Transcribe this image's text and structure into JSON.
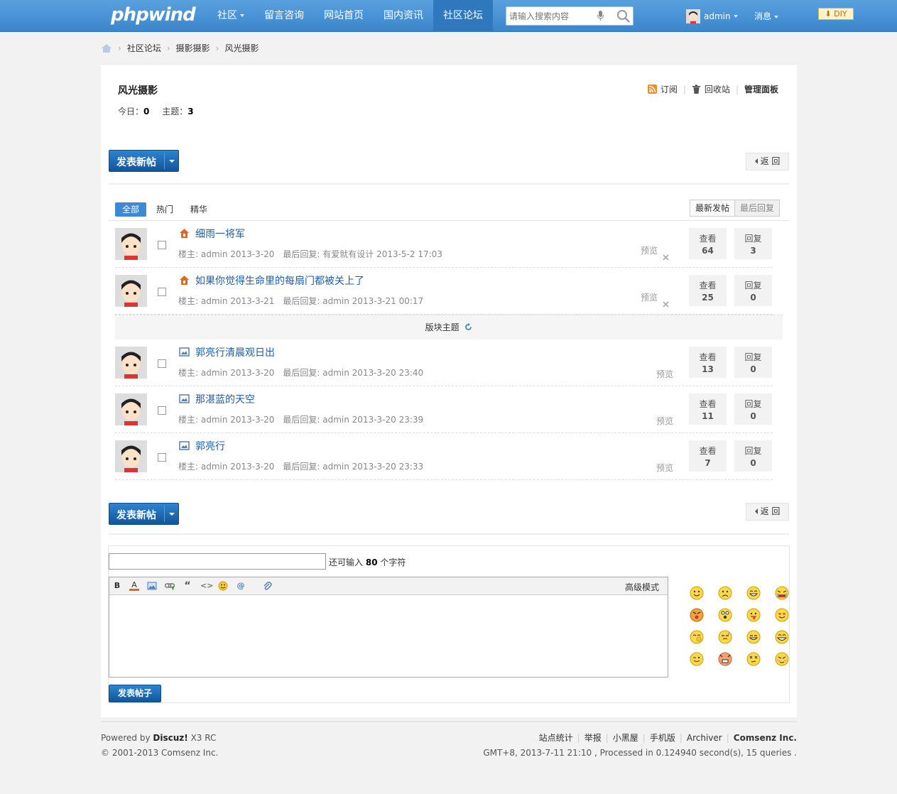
{
  "header": {
    "logo": "phpwind",
    "nav": [
      {
        "label": "社区",
        "has_dropdown": true
      },
      {
        "label": "留言咨询"
      },
      {
        "label": "网站首页"
      },
      {
        "label": "国内资讯"
      },
      {
        "label": "社区论坛",
        "active": true
      }
    ],
    "search_placeholder": "请输入搜索内容",
    "user_name": "admin",
    "messages_label": "消息",
    "diy_label": "DIY"
  },
  "breadcrumb": [
    "社区论坛",
    "摄影摄影",
    "风光摄影"
  ],
  "forum": {
    "title": "风光摄影",
    "today_label": "今日：",
    "today_value": "0",
    "topics_label": "主题：",
    "topics_value": "3",
    "tools": {
      "subscribe": "订阅",
      "recycle": "回收站",
      "manage": "管理面板"
    }
  },
  "buttons": {
    "new_post": "发表新帖",
    "back": "返 回"
  },
  "tabs": [
    "全部",
    "热门",
    "精华"
  ],
  "sort": [
    "最新发帖",
    "最后回复"
  ],
  "sticky_threads": [
    {
      "title": "细雨一将军",
      "owner": "楼主: admin 2013-3-20",
      "last_reply": "最后回复: 有爱就有设计 2013-5-2 17:03",
      "preview": "预览",
      "views_label": "查看",
      "views": "64",
      "replies_label": "回复",
      "replies": "3"
    },
    {
      "title": "如果你觉得生命里的每扇门都被关上了",
      "owner": "楼主: admin 2013-3-21",
      "last_reply": "最后回复: admin 2013-3-21 00:17",
      "preview": "预览",
      "views_label": "查看",
      "views": "25",
      "replies_label": "回复",
      "replies": "0"
    }
  ],
  "section_label": "版块主题",
  "threads": [
    {
      "title": "郭亮行清晨观日出",
      "owner": "楼主: admin 2013-3-20",
      "last_reply": "最后回复: admin 2013-3-20 23:40",
      "preview": "预览",
      "views_label": "查看",
      "views": "13",
      "replies_label": "回复",
      "replies": "0"
    },
    {
      "title": "那湛蓝的天空",
      "owner": "楼主: admin 2013-3-20",
      "last_reply": "最后回复: admin 2013-3-20 23:39",
      "preview": "预览",
      "views_label": "查看",
      "views": "11",
      "replies_label": "回复",
      "replies": "0"
    },
    {
      "title": "郭亮行",
      "owner": "楼主: admin 2013-3-20",
      "last_reply": "最后回复: admin 2013-3-20 23:33",
      "preview": "预览",
      "views_label": "查看",
      "views": "7",
      "replies_label": "回复",
      "replies": "0"
    }
  ],
  "quick_post": {
    "count_prefix": "还可输入",
    "count_value": "80",
    "count_suffix": "个字符",
    "advanced_mode": "高级模式",
    "toolbar_bold": "B",
    "toolbar_font_color": "A",
    "toolbar_quote": "“",
    "toolbar_code": "<>",
    "toolbar_at": "@",
    "submit_label": "发表帖子"
  },
  "footer": {
    "powered_prefix": "Powered by",
    "powered_brand": "Discuz!",
    "powered_version": "X3 RC",
    "copyright": "© 2001-2013 Comsenz Inc.",
    "links": [
      "站点统计",
      "举报",
      "小黑屋",
      "手机版",
      "Archiver",
      "Comsenz Inc."
    ],
    "processed": "GMT+8, 2013-7-11 21:10 , Processed in 0.124940 second(s), 15 queries ."
  },
  "colors": {
    "brand_blue": "#3a86cc",
    "link": "#1f5ea5",
    "sticky_icon": "#e8641b"
  }
}
